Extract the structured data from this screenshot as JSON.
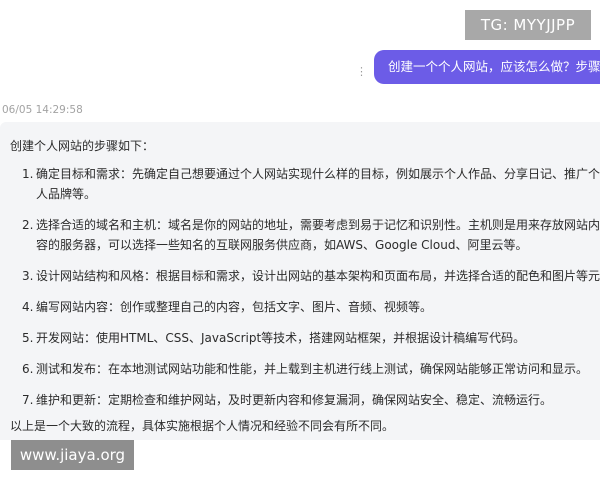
{
  "overlay": {
    "tg_label": "TG: MYYJJPP",
    "watermark": "www.jiaya.org"
  },
  "chat": {
    "user_message": "创建一个个人网站，应该怎么做？步骤",
    "more_icon": "vertical-ellipsis",
    "timestamp": "06/05 14:29:58",
    "answer": {
      "intro": "创建个人网站的步骤如下：",
      "steps": [
        {
          "num": "1.",
          "text": "确定目标和需求：先确定自己想要通过个人网站实现什么样的目标，例如展示个人作品、分享日记、推广个人品牌等。"
        },
        {
          "num": "2.",
          "text": "选择合适的域名和主机：域名是你的网站的地址，需要考虑到易于记忆和识别性。主机则是用来存放网站内容的服务器，可以选择一些知名的互联网服务供应商，如AWS、Google Cloud、阿里云等。"
        },
        {
          "num": "3.",
          "text": "设计网站结构和风格：根据目标和需求，设计出网站的基本架构和页面布局，并选择合适的配色和图片等元素。"
        },
        {
          "num": "4.",
          "text": "编写网站内容：创作或整理自己的内容，包括文字、图片、音频、视频等。"
        },
        {
          "num": "5.",
          "text": "开发网站：使用HTML、CSS、JavaScript等技术，搭建网站框架，并根据设计稿编写代码。"
        },
        {
          "num": "6.",
          "text": "测试和发布：在本地测试网站功能和性能，并上载到主机进行线上测试，确保网站能够正常访问和显示。"
        },
        {
          "num": "7.",
          "text": "维护和更新：定期检查和维护网站，及时更新内容和修复漏洞，确保网站安全、稳定、流畅运行。"
        }
      ],
      "outro": "以上是一个大致的流程，具体实施根据个人情况和经验不同会有所不同。"
    }
  },
  "colors": {
    "user_bubble": "#6c5ce7",
    "answer_panel": "#f4f5f7",
    "tg_badge": "#a8a8a8",
    "watermark": "#8e8e8e"
  }
}
